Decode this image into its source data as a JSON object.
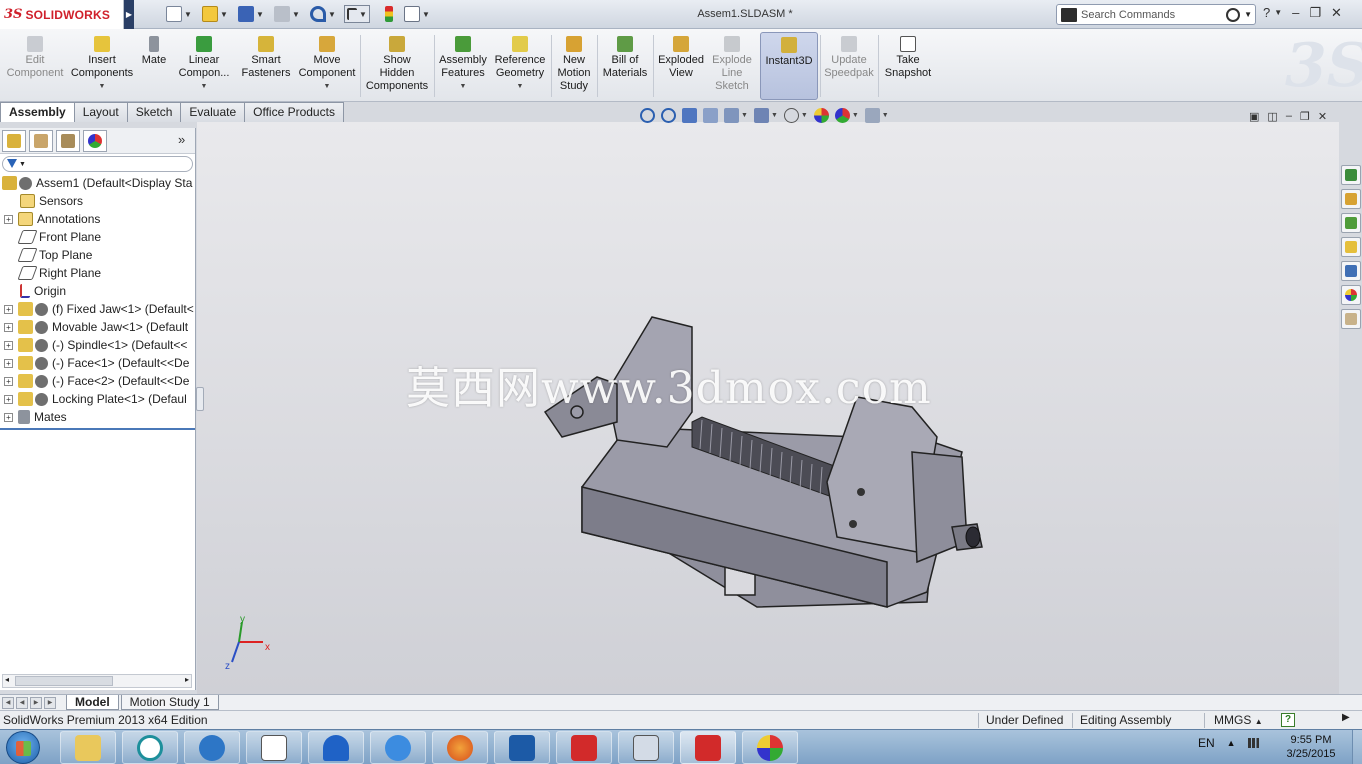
{
  "titlebar": {
    "brand_prefix": "3S",
    "brand": "SOLIDWORKS",
    "document_title": "Assem1.SLDASM *",
    "search_placeholder": "Search Commands",
    "help_label": "?"
  },
  "command_manager": {
    "buttons": [
      {
        "label_1": "Edit",
        "label_2": "Component",
        "enabled": false
      },
      {
        "label_1": "Insert",
        "label_2": "Components",
        "enabled": true
      },
      {
        "label_1": "Mate",
        "label_2": "",
        "enabled": true
      },
      {
        "label_1": "Linear",
        "label_2": "Compon...",
        "enabled": true
      },
      {
        "label_1": "Smart",
        "label_2": "Fasteners",
        "enabled": true
      },
      {
        "label_1": "Move",
        "label_2": "Component",
        "enabled": true
      },
      {
        "label_1": "Show",
        "label_2": "Hidden",
        "label_3": "Components",
        "enabled": true
      },
      {
        "label_1": "Assembly",
        "label_2": "Features",
        "enabled": true
      },
      {
        "label_1": "Reference",
        "label_2": "Geometry",
        "enabled": true
      },
      {
        "label_1": "New",
        "label_2": "Motion",
        "label_3": "Study",
        "enabled": true
      },
      {
        "label_1": "Bill of",
        "label_2": "Materials",
        "enabled": true
      },
      {
        "label_1": "Exploded",
        "label_2": "View",
        "enabled": true
      },
      {
        "label_1": "Explode",
        "label_2": "Line",
        "label_3": "Sketch",
        "enabled": false
      },
      {
        "label_1": "Instant3D",
        "label_2": "",
        "enabled": true,
        "active": true
      },
      {
        "label_1": "Update",
        "label_2": "Speedpak",
        "enabled": false
      },
      {
        "label_1": "Take",
        "label_2": "Snapshot",
        "enabled": true
      }
    ]
  },
  "tabs": [
    "Assembly",
    "Layout",
    "Sketch",
    "Evaluate",
    "Office Products"
  ],
  "active_tab": "Assembly",
  "feature_tree": {
    "panel_more": "»",
    "nodes": [
      {
        "label": "Assem1  (Default<Display Sta",
        "expander": false
      },
      {
        "label": "Sensors",
        "expander": false
      },
      {
        "label": "Annotations",
        "expander": true
      },
      {
        "label": "Front Plane",
        "expander": false
      },
      {
        "label": "Top Plane",
        "expander": false
      },
      {
        "label": "Right Plane",
        "expander": false
      },
      {
        "label": "Origin",
        "expander": false
      },
      {
        "label": "(f) Fixed Jaw<1> (Default<",
        "expander": true
      },
      {
        "label": "Movable Jaw<1> (Default",
        "expander": true
      },
      {
        "label": "(-) Spindle<1> (Default<<",
        "expander": true
      },
      {
        "label": "(-) Face<1> (Default<<De",
        "expander": true
      },
      {
        "label": "(-) Face<2> (Default<<De",
        "expander": true
      },
      {
        "label": "Locking Plate<1> (Defaul",
        "expander": true
      },
      {
        "label": "Mates",
        "expander": true
      }
    ]
  },
  "viewport": {
    "watermark": "莫西网www.3dmox.com",
    "triad": {
      "x": "x",
      "y": "y",
      "z": "z"
    }
  },
  "bottom_tabs": [
    "Model",
    "Motion Study 1"
  ],
  "active_bottom_tab": "Model",
  "status_bar": {
    "edition": "SolidWorks Premium 2013 x64 Edition",
    "state": "Under Defined",
    "mode": "Editing Assembly",
    "units": "MMGS",
    "units_caret": "▲"
  },
  "taskbar": {
    "language": "EN",
    "time": "9:55 PM",
    "date": "3/25/2015"
  },
  "colors": {
    "accent": "#d0202b",
    "part_gray": "#8f8f9c",
    "viewport_top": "#e9e9ec",
    "viewport_bottom": "#cfd0d6"
  }
}
